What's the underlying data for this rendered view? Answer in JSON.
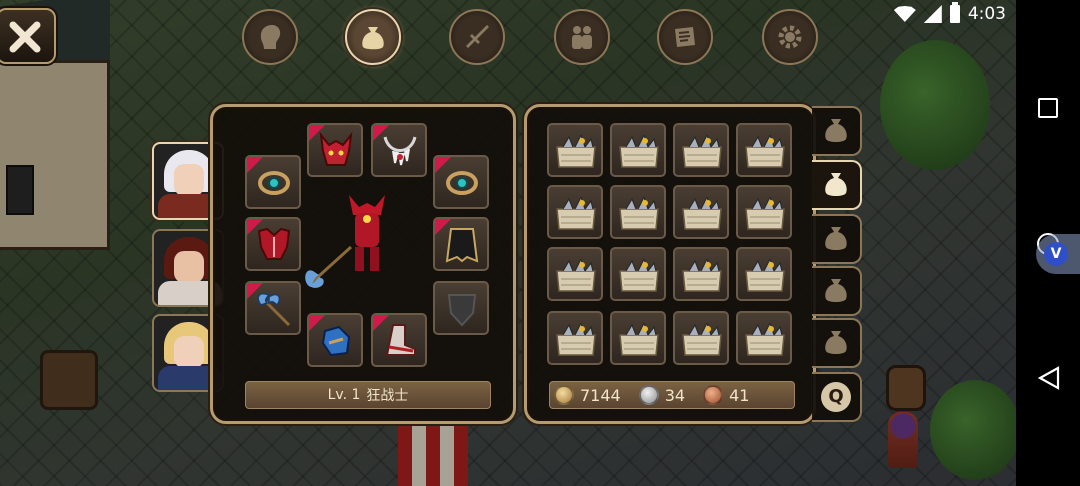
{
  "status_bar": {
    "time": "4:03"
  },
  "menu": {
    "items": [
      {
        "name": "character"
      },
      {
        "name": "bag",
        "active": true
      },
      {
        "name": "skills"
      },
      {
        "name": "party"
      },
      {
        "name": "quests"
      },
      {
        "name": "settings"
      }
    ]
  },
  "character": {
    "level_prefix": "Lv. 1",
    "class_name": "狂战士"
  },
  "currency": {
    "gold": "7144",
    "silver": "34",
    "copper": "41"
  },
  "bag_tabs": {
    "special_label": "Q"
  },
  "colors": {
    "panel_border": "#b59b70",
    "new_marker": "#d01a4a",
    "label_bg": "#6b5239"
  }
}
